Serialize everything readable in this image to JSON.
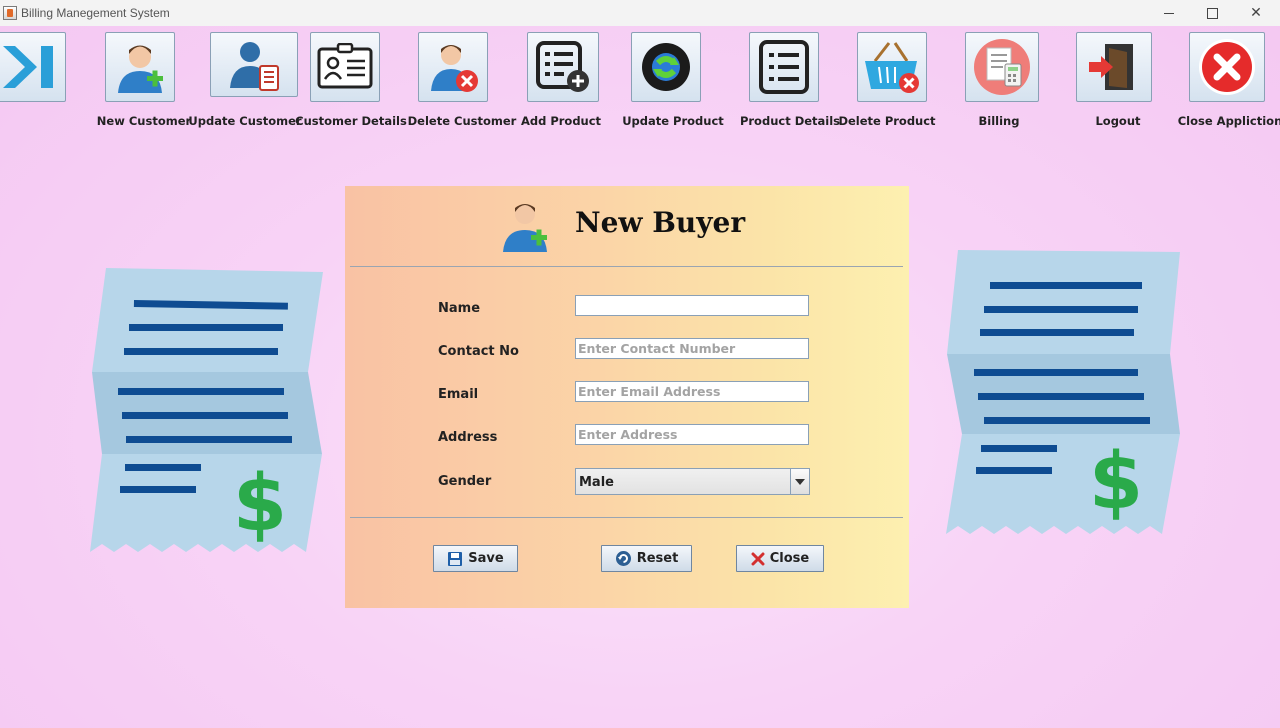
{
  "window": {
    "title": "Billing Manegement System",
    "controls": {
      "minimize": "minimize",
      "maximize": "maximize",
      "close": "✕"
    }
  },
  "toolbar": {
    "items": [
      {
        "label": "",
        "icon": "collapse-arrow-icon"
      },
      {
        "label": "New Customer",
        "icon": "user-add-icon"
      },
      {
        "label": "Update Customer",
        "icon": "user-edit-icon"
      },
      {
        "label": "Customer Details",
        "icon": "id-card-icon"
      },
      {
        "label": "Delete Customer",
        "icon": "user-delete-icon"
      },
      {
        "label": "Add Product",
        "icon": "list-add-icon"
      },
      {
        "label": "Update Product",
        "icon": "refresh-globe-icon"
      },
      {
        "label": "Product Details",
        "icon": "list-icon"
      },
      {
        "label": "Delete Product",
        "icon": "basket-delete-icon"
      },
      {
        "label": "Billing",
        "icon": "bill-calculator-icon"
      },
      {
        "label": "Logout",
        "icon": "logout-door-icon"
      },
      {
        "label": "Close Appliction",
        "icon": "close-circle-icon"
      }
    ]
  },
  "form": {
    "title": "New Buyer",
    "fields": {
      "name": {
        "label": "Name",
        "value": "",
        "placeholder": ""
      },
      "contact": {
        "label": "Contact No",
        "value": "",
        "placeholder": "Enter Contact Number"
      },
      "email": {
        "label": "Email",
        "value": "",
        "placeholder": "Enter Email Address"
      },
      "address": {
        "label": "Address",
        "value": "",
        "placeholder": "Enter Address"
      },
      "gender": {
        "label": "Gender",
        "value": "Male"
      }
    },
    "buttons": {
      "save": "Save",
      "reset": "Reset",
      "close": "Close"
    }
  },
  "decor": {
    "receipt_symbol": "$",
    "colors": {
      "receipt": "#b7d6ea",
      "receipt_fold": "#a5c8df",
      "receipt_lines": "#0e4c92",
      "dollar": "#2aaa4a"
    }
  }
}
